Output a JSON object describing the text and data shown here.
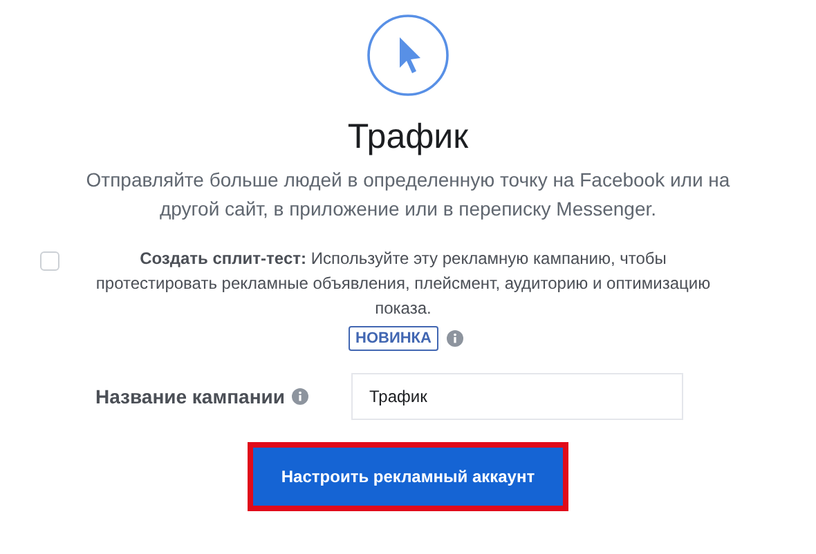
{
  "title": "Трафик",
  "description": "Отправляйте больше людей в определенную точку на Facebook или на другой сайт, в приложение или в переписку Messenger.",
  "split_test": {
    "checked": false,
    "text": "**Создать сплит-тест:** Используйте эту рекламную кампанию, чтобы протестировать рекламные объявления, плейсмент, аудиторию и оптимизацию показа.",
    "badge": "НОВИНКА"
  },
  "campaign_name": {
    "label": "Название кампании",
    "value": "Трафик"
  },
  "button": {
    "label": "Настроить рекламный аккаунт",
    "highlighted": true
  }
}
